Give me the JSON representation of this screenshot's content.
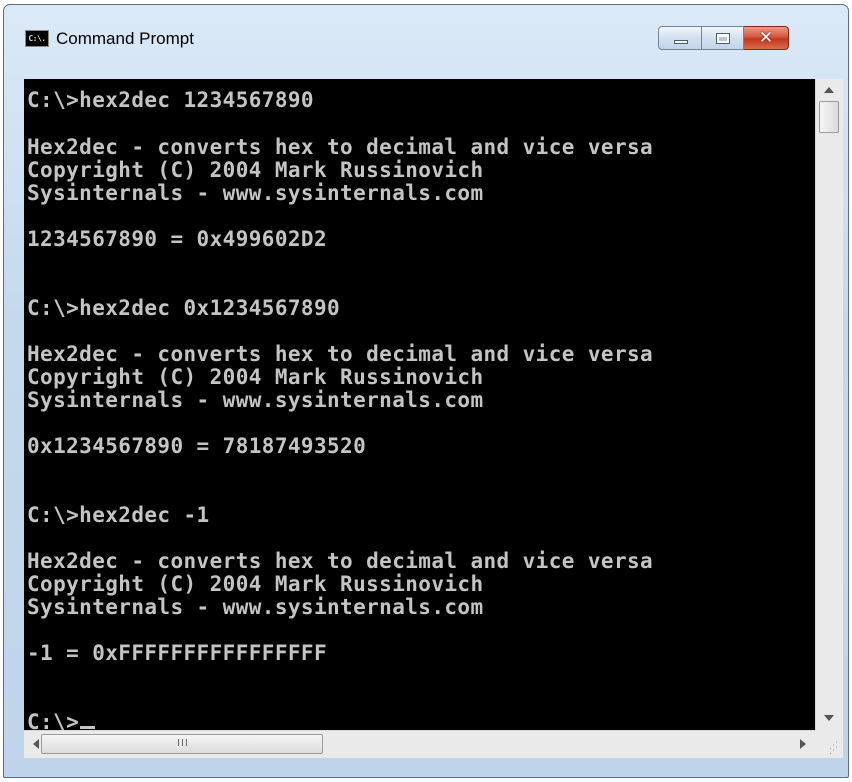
{
  "window": {
    "title": "Command Prompt",
    "icon_label": "C:\\.",
    "icon": "console-app-icon",
    "buttons": {
      "minimize": "minimize-icon",
      "maximize": "maximize-icon",
      "close": "✕"
    }
  },
  "console": {
    "lines": [
      "C:\\>hex2dec 1234567890",
      "Hex2dec - converts hex to decimal and vice versa",
      "Copyright (C) 2004 Mark Russinovich",
      "Sysinternals - www.sysinternals.com",
      "1234567890 = 0x499602D2",
      "C:\\>hex2dec 0x1234567890",
      "Hex2dec - converts hex to decimal and vice versa",
      "Copyright (C) 2004 Mark Russinovich",
      "Sysinternals - www.sysinternals.com",
      "0x1234567890 = 78187493520",
      "C:\\>hex2dec -1",
      "Hex2dec - converts hex to decimal and vice versa",
      "Copyright (C) 2004 Mark Russinovich",
      "Sysinternals - www.sysinternals.com",
      "-1 = 0xFFFFFFFFFFFFFFFF",
      "C:\\>"
    ]
  },
  "scrollbars": {
    "horizontal_grip": "III",
    "colors": {
      "console_bg": "#000000",
      "console_text": "#c4c4c4"
    }
  }
}
